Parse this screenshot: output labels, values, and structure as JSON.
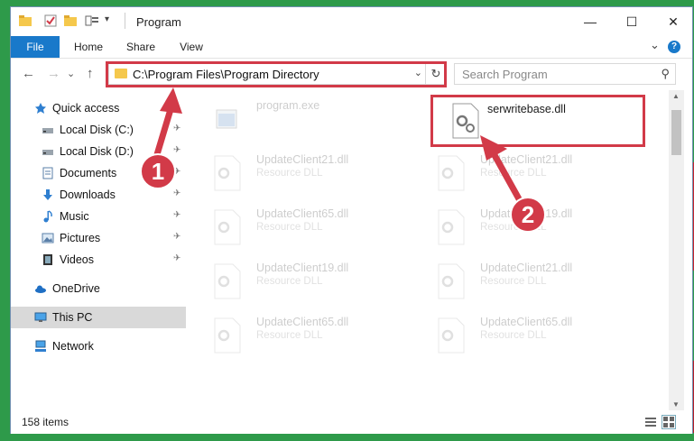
{
  "window": {
    "title": "Program",
    "minimize_symbol": "—",
    "maximize_symbol": "☐",
    "close_symbol": "✕"
  },
  "ribbon": {
    "tabs": [
      "File",
      "Home",
      "Share",
      "View"
    ],
    "expand_symbol": "⌄",
    "help_symbol": "?"
  },
  "nav": {
    "back_symbol": "←",
    "forward_symbol": "→",
    "recent_symbol": "⌄",
    "up_symbol": "↑",
    "address": "C:\\Program Files\\Program Directory",
    "address_dropdown_symbol": "⌄",
    "refresh_symbol": "↻",
    "search_placeholder": "Search Program",
    "search_symbol": "⚲"
  },
  "sidebar": {
    "items": [
      {
        "label": "Quick access",
        "icon": "star-icon",
        "pinned": false
      },
      {
        "label": "Local Disk (C:)",
        "icon": "drive-icon",
        "pinned": true
      },
      {
        "label": "Local Disk (D:)",
        "icon": "drive-icon",
        "pinned": true
      },
      {
        "label": "Documents",
        "icon": "documents-icon",
        "pinned": true
      },
      {
        "label": "Downloads",
        "icon": "download-icon",
        "pinned": true
      },
      {
        "label": "Music",
        "icon": "music-icon",
        "pinned": true
      },
      {
        "label": "Pictures",
        "icon": "pictures-icon",
        "pinned": true
      },
      {
        "label": "Videos",
        "icon": "videos-icon",
        "pinned": true
      },
      {
        "label": "OneDrive",
        "icon": "cloud-icon",
        "pinned": false
      },
      {
        "label": "This PC",
        "icon": "computer-icon",
        "pinned": false,
        "selected": true
      },
      {
        "label": "Network",
        "icon": "network-icon",
        "pinned": false
      }
    ],
    "pin_symbol": "📌"
  },
  "files": [
    {
      "name": "program.exe",
      "desc": "",
      "faded": true
    },
    {
      "name": "serwritebase.dll",
      "desc": "",
      "faded": false,
      "highlighted": true
    },
    {
      "name": "UpdateClient21.dll",
      "desc": "Resource DLL",
      "faded": true
    },
    {
      "name": "UpdateClient21.dll",
      "desc": "Resource DLL",
      "faded": true
    },
    {
      "name": "UpdateClient65.dll",
      "desc": "Resource DLL",
      "faded": true
    },
    {
      "name": "UpdateClient19.dll",
      "desc": "Resource DLL",
      "faded": true
    },
    {
      "name": "UpdateClient19.dll",
      "desc": "Resource DLL",
      "faded": true
    },
    {
      "name": "UpdateClient21.dll",
      "desc": "Resource DLL",
      "faded": true
    },
    {
      "name": "UpdateClient65.dll",
      "desc": "Resource DLL",
      "faded": true
    },
    {
      "name": "UpdateClient65.dll",
      "desc": "Resource DLL",
      "faded": true
    }
  ],
  "status": {
    "item_count": "158 items"
  },
  "annotations": {
    "step1": "1",
    "step2": "2",
    "color": "#d23a48"
  },
  "colors": {
    "accent": "#1979ca",
    "background": "#2e9a4a"
  }
}
